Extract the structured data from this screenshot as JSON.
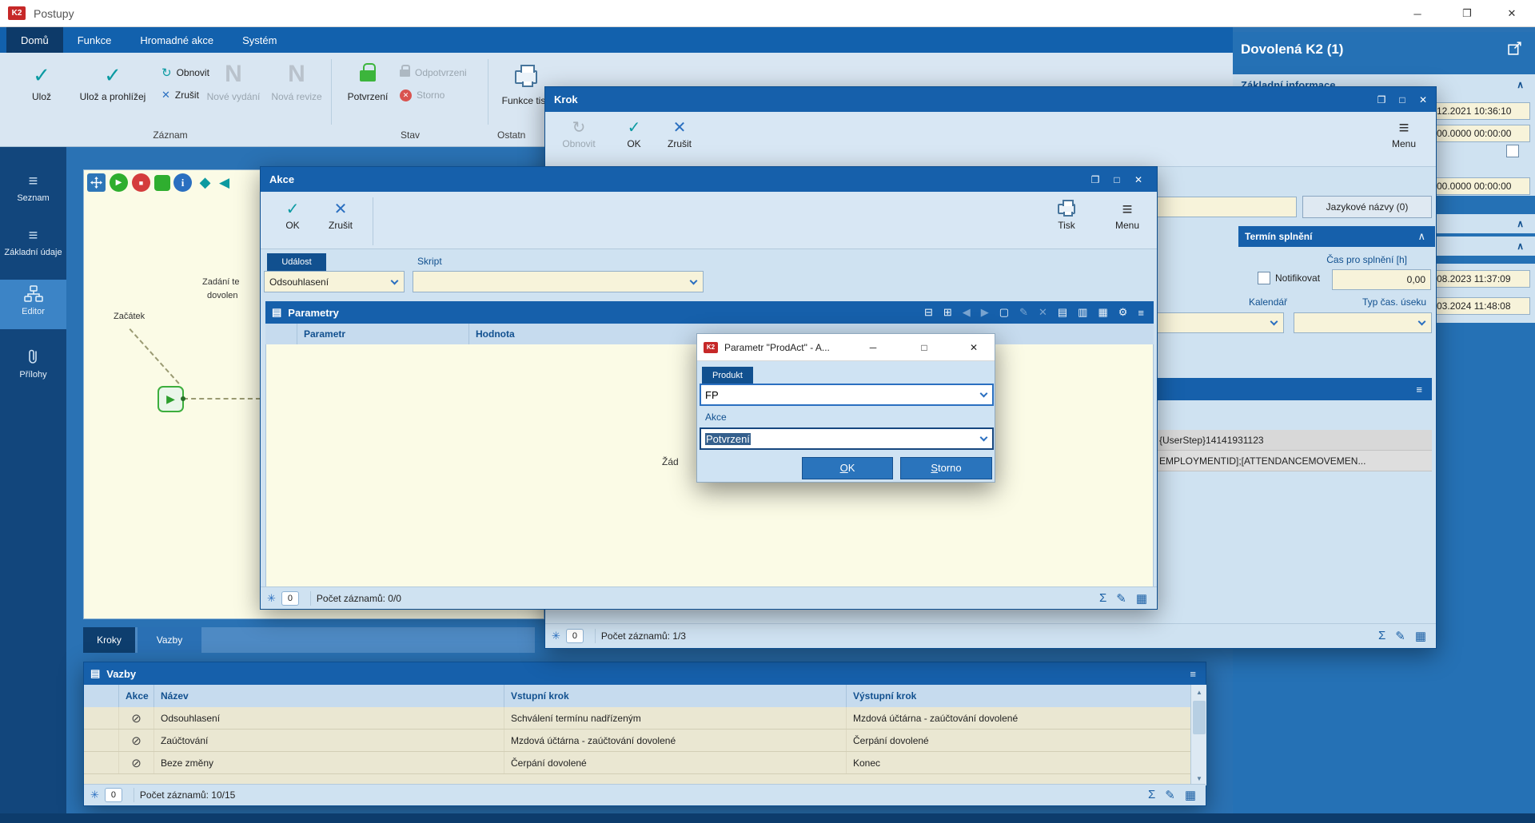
{
  "icons": {
    "minimize": "─",
    "maximize": "□",
    "restore": "❐",
    "close": "✕",
    "menu": "≡",
    "check": "✓",
    "cross": "✕",
    "refresh": "↻",
    "sum": "Σ",
    "edit": "✎",
    "grid": "▦",
    "asterisk": "✳",
    "book": "▤",
    "chevron_up": "∧",
    "play": "▶",
    "back": "◀",
    "diamond": "◆",
    "square": "■",
    "info": "i",
    "action_check": "⊘",
    "up": "▲",
    "down": "▼",
    "n_letter": "N",
    "param_toolbar": [
      "⊟",
      "⊞",
      "◀",
      "▶",
      "▢",
      "✎",
      "✕",
      "▤",
      "▥",
      "▦",
      "⚙",
      "≡"
    ]
  },
  "titlebar": {
    "title": "Postupy",
    "logo": "K2"
  },
  "ribbon": {
    "tabs": [
      {
        "label": "Domů"
      },
      {
        "label": "Funkce"
      },
      {
        "label": "Hromadné akce"
      },
      {
        "label": "Systém"
      }
    ],
    "save": "Ulož",
    "save_and_view": "Ulož a prohlížej",
    "refresh": "Obnovit",
    "cancel": "Zrušit",
    "new_issue": "Nové vydání",
    "new_revision": "Nová revize",
    "confirm": "Potvrzení",
    "unconfirm": "Odpotvrzeni",
    "storno": "Storno",
    "print_functions": "Funkce tisk",
    "group_record": "Záznam",
    "group_state": "Stav",
    "group_other": "Ostatn"
  },
  "sidebar": {
    "items": [
      {
        "label": "Seznam"
      },
      {
        "label": "Základní údaje"
      },
      {
        "label": "Editor"
      },
      {
        "label": "Přílohy"
      }
    ]
  },
  "canvas": {
    "start_label": "Začátek",
    "step_label_line1": "Zadání te",
    "step_label_line2": "dovolen"
  },
  "tabs": {
    "kroky": "Kroky",
    "vazby": "Vazby"
  },
  "vazby": {
    "title": "Vazby",
    "columns": {
      "akce": "Akce",
      "nazev": "Název",
      "vstup": "Vstupní krok",
      "vystup": "Výstupní krok"
    },
    "rows": [
      {
        "nazev": "Odsouhlasení",
        "vstup": "Schválení termínu nadřízeným",
        "vystup": "Mzdová účtárna - zaúčtování dovolené"
      },
      {
        "nazev": "Zaúčtování",
        "vstup": "Mzdová účtárna - zaúčtování dovolené",
        "vystup": "Čerpání dovolené"
      },
      {
        "nazev": "Beze změny",
        "vstup": "Čerpání dovolené",
        "vystup": "Konec"
      }
    ],
    "counter": "0",
    "records": "Počet záznamů: 10/15"
  },
  "krok": {
    "title": "Krok",
    "refresh": "Obnovit",
    "ok": "OK",
    "cancel": "Zrušit",
    "menu": "Menu",
    "language_names": "Jazykové názvy (0)",
    "section_deadline": "Termín splnění",
    "time_label": "Čas pro splnění [h]",
    "notify": "Notifikovat",
    "time_value": "0,00",
    "calendar": "Kalendář",
    "time_unit": "Typ čas. úseku",
    "grid_row1": "{UserStep}14141931123",
    "grid_row2": "EMPLOYMENTID];[ATTENDANCEMOVEMEN...",
    "counter": "0",
    "records": "Počet záznamů: 1/3"
  },
  "akce": {
    "title": "Akce",
    "ok": "OK",
    "cancel": "Zrušit",
    "print": "Tisk",
    "menu": "Menu",
    "event_label": "Událost",
    "event_value": "Odsouhlasení",
    "script_label": "Skript",
    "parametry_title": "Parametry",
    "col_parametr": "Parametr",
    "col_hodnota": "Hodnota",
    "empty_text": "Žád",
    "counter": "0",
    "records": "Počet záznamů: 0/0"
  },
  "dialog": {
    "title": "Parametr \"ProdAct\" - A...",
    "logo": "K2",
    "produkt_label": "Produkt",
    "produkt_value": "FP",
    "akce_label": "Akce",
    "akce_value": "Potvrzení",
    "ok": "OK",
    "storno": "Storno"
  },
  "right_panel": {
    "title": "Dovolená K2 (1)",
    "section_basic": "Základní informace",
    "value1": "12.2021 10:36:10",
    "value2": "00.0000 00:00:00",
    "value3": "00.0000 00:00:00",
    "value4": "08.2023 11:37:09",
    "value5": "03.2024 11:48:08"
  }
}
